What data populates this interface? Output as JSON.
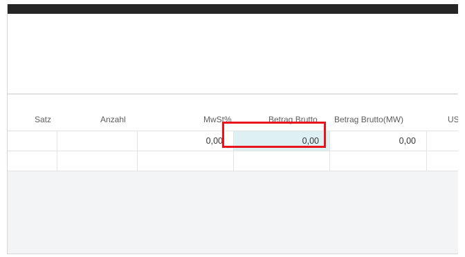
{
  "table": {
    "headers": {
      "satz": "Satz",
      "anzahl": "Anzahl",
      "mwst": "MwSt%",
      "betrag_brutto": "Betrag Brutto",
      "betrag_brutto_mw": "Betrag Brutto(MW)",
      "ust": "US"
    },
    "rows": [
      {
        "satz": "",
        "anzahl": "",
        "mwst": "0,00",
        "betrag_brutto": "0,00",
        "betrag_brutto_mw": "0,00",
        "ust": ""
      },
      {
        "satz": "",
        "anzahl": "",
        "mwst": "",
        "betrag_brutto": "",
        "betrag_brutto_mw": "",
        "ust": ""
      }
    ]
  },
  "colors": {
    "topbar": "#262626",
    "selected_cell": "#dff0f2",
    "highlight": "#e8141b",
    "empty_area": "#f3f4f5"
  }
}
